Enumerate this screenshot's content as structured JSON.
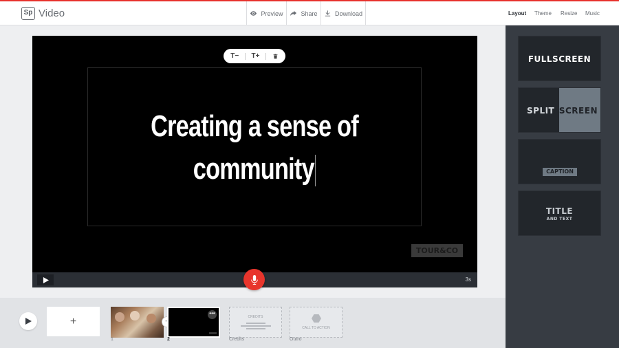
{
  "header": {
    "logo": "Sp",
    "app_name": "Video",
    "preview_label": "Preview",
    "share_label": "Share",
    "download_label": "Download",
    "tabs": [
      {
        "label": "Layout",
        "active": true
      },
      {
        "label": "Theme",
        "active": false
      },
      {
        "label": "Resize",
        "active": false
      },
      {
        "label": "Music",
        "active": false
      }
    ]
  },
  "layouts": {
    "fullscreen": "FULLSCREEN",
    "split_left": "SPLIT",
    "split_right": "SCREEN",
    "caption": "CAPTION",
    "title_main": "TITLE",
    "title_sub": "AND TEXT"
  },
  "stage": {
    "headline_line1": "Creating a sense of",
    "headline_line2": "community",
    "text_toolbar": {
      "decrease": "T−",
      "increase": "T+"
    },
    "brand_logo": "TOUR&CO",
    "duration": "3s"
  },
  "timeline": {
    "add_label": "+",
    "slides": [
      {
        "label": "1",
        "active": false
      },
      {
        "label": "2",
        "active": true
      },
      {
        "label": "Credits",
        "active": false,
        "inner": "CREDITS"
      },
      {
        "label": "Outro",
        "active": false,
        "inner": "CALL TO ACTION"
      }
    ],
    "more_label": "•••"
  },
  "colors": {
    "accent": "#e7322d",
    "mic": "#e8352c",
    "panel": "#373c43"
  }
}
